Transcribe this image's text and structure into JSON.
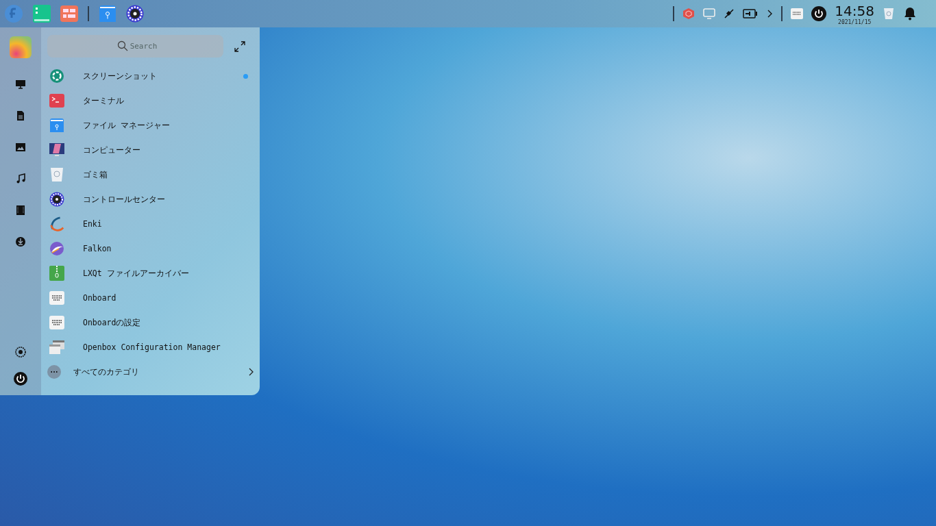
{
  "taskbar": {
    "clock": {
      "time": "14:58",
      "date": "2021/11/15"
    }
  },
  "launcher": {
    "search": {
      "placeholder": "Search"
    },
    "apps": [
      {
        "label": "スクリーンショット",
        "kind": "screenshot",
        "new": true
      },
      {
        "label": "ターミナル",
        "kind": "terminal",
        "new": false
      },
      {
        "label": "ファイル マネージャー",
        "kind": "folder",
        "new": false
      },
      {
        "label": "コンピューター",
        "kind": "computer",
        "new": false
      },
      {
        "label": "ゴミ箱",
        "kind": "trash",
        "new": false
      },
      {
        "label": "コントロールセンター",
        "kind": "gear",
        "new": false
      },
      {
        "label": "Enki",
        "kind": "enki",
        "new": false
      },
      {
        "label": "Falkon",
        "kind": "falkon",
        "new": false
      },
      {
        "label": "LXQt ファイルアーカイバー",
        "kind": "archive",
        "new": false
      },
      {
        "label": "Onboard",
        "kind": "keyboard",
        "new": false
      },
      {
        "label": "Onboardの設定",
        "kind": "keyboard",
        "new": false
      },
      {
        "label": "Openbox Configuration Manager",
        "kind": "windows",
        "new": false
      }
    ],
    "all_categories": "すべてのカテゴリ"
  }
}
